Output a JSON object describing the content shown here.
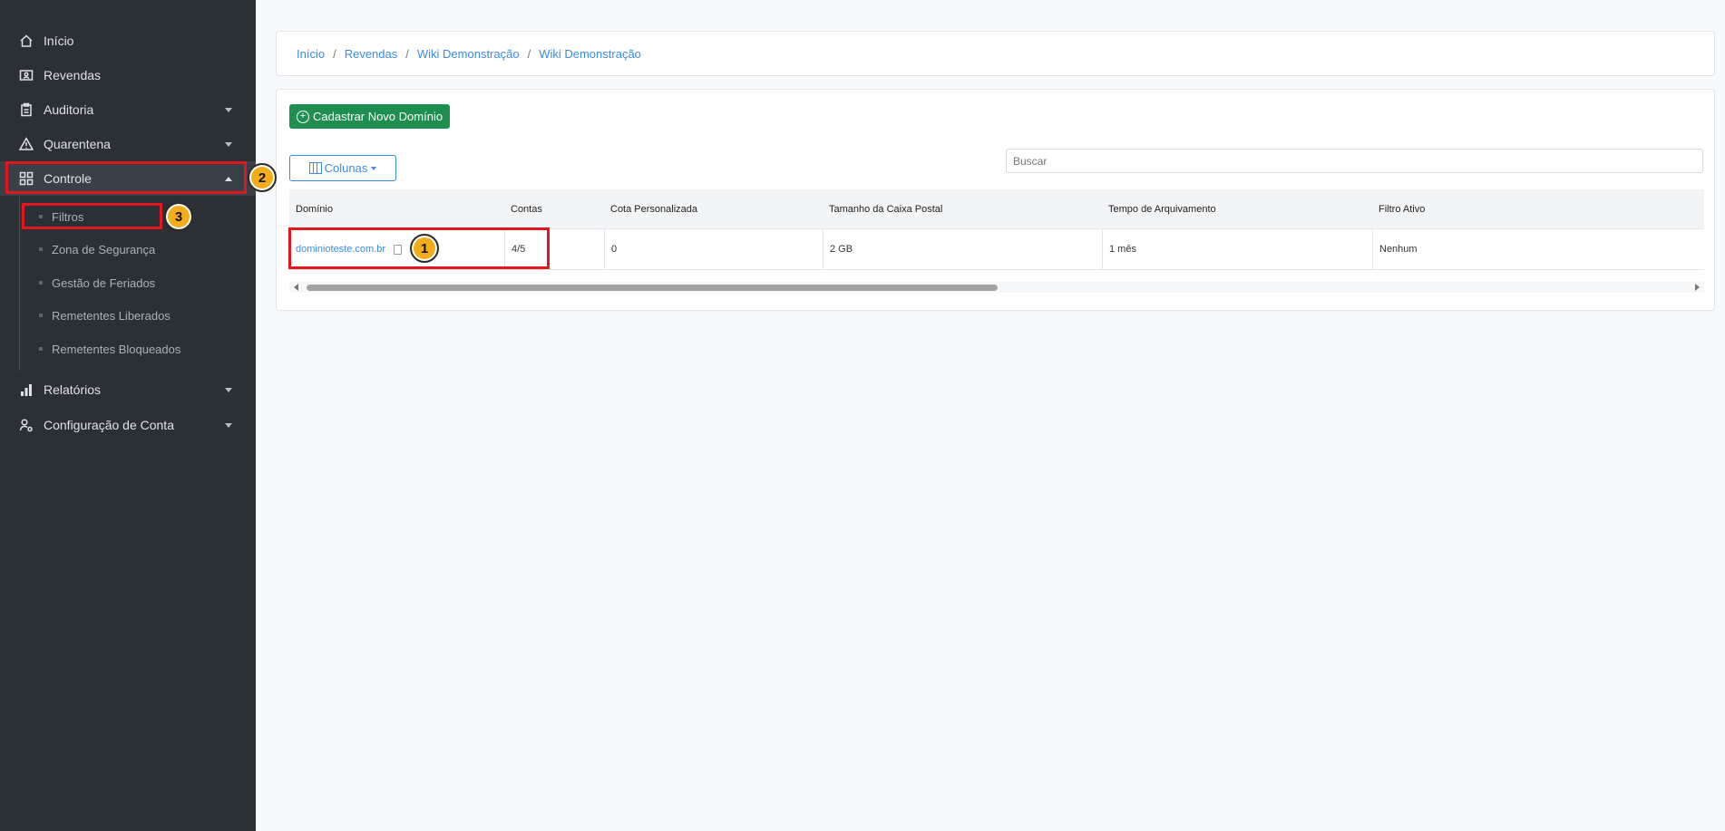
{
  "sidebar": {
    "items": [
      {
        "label": "Início",
        "icon": "home-icon"
      },
      {
        "label": "Revendas",
        "icon": "id-card-icon"
      },
      {
        "label": "Auditoria",
        "icon": "clipboard-icon"
      },
      {
        "label": "Quarentena",
        "icon": "warning-icon"
      },
      {
        "label": "Controle",
        "icon": "grid-icon"
      },
      {
        "label": "Relatórios",
        "icon": "bar-chart-icon"
      },
      {
        "label": "Configuração de Conta",
        "icon": "user-cog-icon"
      }
    ],
    "subitems": [
      "Filtros",
      "Zona de Segurança",
      "Gestão de Feriados",
      "Remetentes Liberados",
      "Remetentes Bloqueados"
    ]
  },
  "breadcrumb": [
    "Início",
    "Revendas",
    "Wiki Demonstração",
    "Wiki Demonstração"
  ],
  "breadcrumb_sep": "/",
  "toolbar": {
    "new_domain_label": "Cadastrar Novo Domínio",
    "columns_label": "Colunas",
    "search_placeholder": "Buscar"
  },
  "table": {
    "headers": [
      "Domínio",
      "Contas",
      "Cota Personalizada",
      "Tamanho da Caixa Postal",
      "Tempo de Arquivamento",
      "Filtro Ativo"
    ],
    "rows": [
      [
        "dominioteste.com.br",
        "4/5",
        "0",
        "2 GB",
        "1 mês",
        "Nenhum"
      ]
    ]
  },
  "annotations": {
    "badge1": "1",
    "badge2": "2",
    "badge3": "3"
  },
  "colors": {
    "accent": "#3d8ae6",
    "primary_green": "#1e8f4e",
    "highlight": "#e3161d",
    "badge": "#f4ad1a",
    "sidebar_bg": "#2b3035"
  }
}
